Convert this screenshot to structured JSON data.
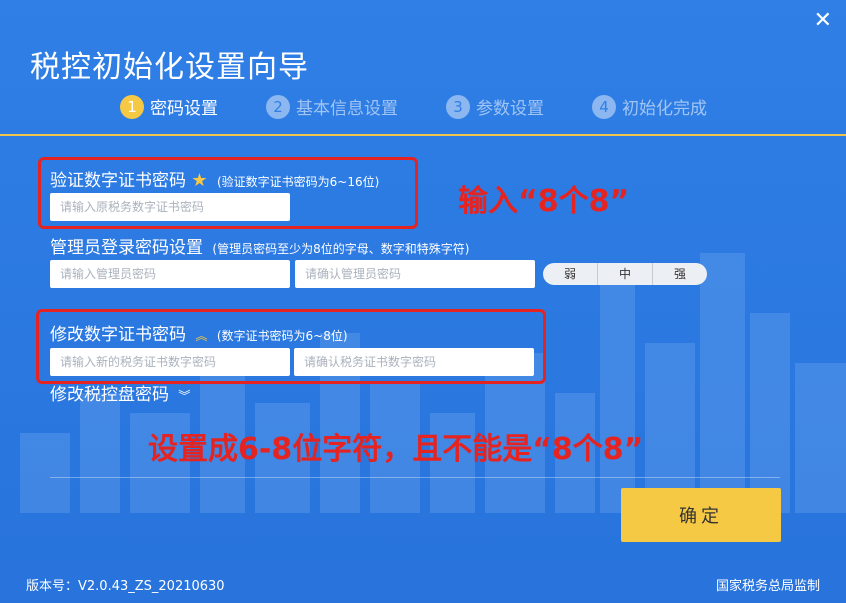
{
  "window": {
    "title": "税控初始化设置向导",
    "close_glyph": "✕"
  },
  "steps": [
    {
      "num": "1",
      "label": "密码设置"
    },
    {
      "num": "2",
      "label": "基本信息设置"
    },
    {
      "num": "3",
      "label": "参数设置"
    },
    {
      "num": "4",
      "label": "初始化完成"
    }
  ],
  "verify_cert": {
    "label": "验证数字证书密码",
    "star": "★",
    "hint": "(验证数字证书密码为6~16位)",
    "placeholder": "请输入原税务数字证书密码"
  },
  "admin": {
    "label": "管理员登录密码设置",
    "hint": "(管理员密码至少为8位的字母、数字和特殊字符)",
    "placeholder": "请输入管理员密码",
    "confirm_placeholder": "请确认管理员密码",
    "strength": [
      "弱",
      "中",
      "强"
    ]
  },
  "modify_cert": {
    "label": "修改数字证书密码",
    "toggle_glyph": "︽",
    "hint": "(数字证书密码为6~8位)",
    "placeholder": "请输入新的税务证书数字密码",
    "confirm_placeholder": "请确认税务证书数字密码"
  },
  "modify_disk": {
    "label": "修改税控盘密码",
    "toggle_glyph": "︾"
  },
  "annotations": {
    "top": "输入“8个8”",
    "bottom": "设置成6-8位字符，且不能是“8个8”"
  },
  "ok_button": "确定",
  "footer": {
    "version": "版本号：V2.0.43_ZS_20210630",
    "supervisor": "国家税务总局监制"
  },
  "colors": {
    "background": "#2f7fe6",
    "accent": "#f6c945",
    "annotation": "#e52421"
  }
}
